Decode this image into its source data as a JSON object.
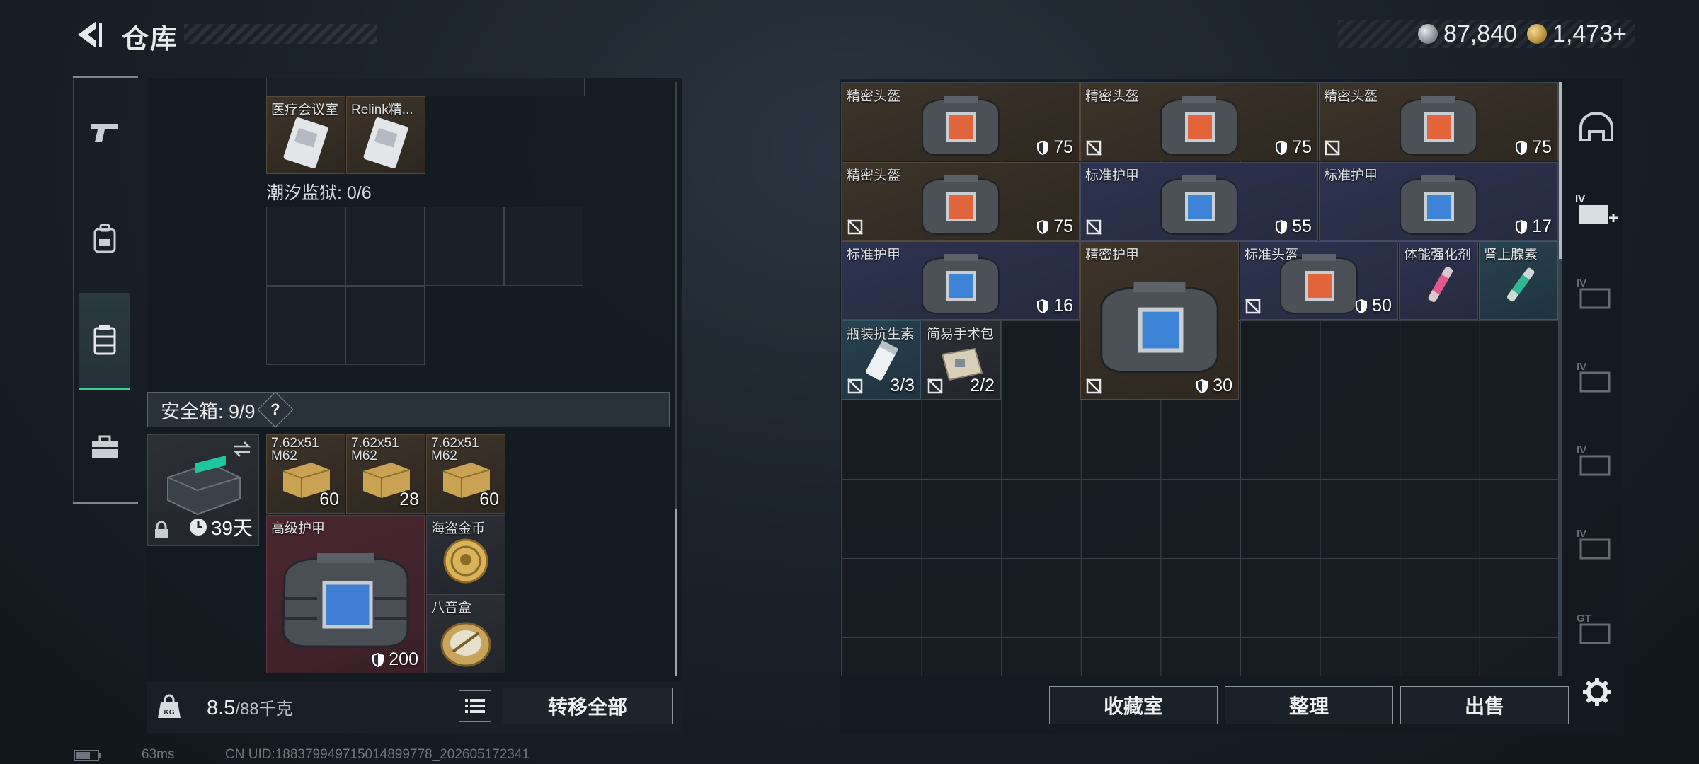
{
  "header": {
    "title": "仓库",
    "silver_value": "87,840",
    "gold_value": "1,473",
    "plus": "+"
  },
  "left_panel": {
    "top_items": [
      {
        "label": "医疗会议室",
        "kind": "keycard"
      },
      {
        "label": "Relink精...",
        "kind": "keycard"
      }
    ],
    "prison_label": "潮汐监狱: 0/6",
    "safebox_label": "安全箱: 9/9",
    "safebox_help": "?",
    "safebox_timer": "39天",
    "ammo": [
      {
        "label": "7.62x51\nM62",
        "count": "60"
      },
      {
        "label": "7.62x51\nM62",
        "count": "28"
      },
      {
        "label": "7.62x51\nM62",
        "count": "60"
      }
    ],
    "armor_label": "高级护甲",
    "armor_dura": "200",
    "coin_label": "海盗金币",
    "music_box_label": "八音盒",
    "weight_value": "8.5",
    "weight_max": "/88千克",
    "transfer_button": "转移全部"
  },
  "right_panel": {
    "items": [
      {
        "label": "精密头盔",
        "dura": "75",
        "color": "brown",
        "screen": "orange",
        "noins": false
      },
      {
        "label": "精密头盔",
        "dura": "75",
        "color": "brown",
        "screen": "orange",
        "noins": true
      },
      {
        "label": "精密头盔",
        "dura": "75",
        "color": "brown",
        "screen": "orange",
        "noins": true
      },
      {
        "label": "精密头盔",
        "dura": "75",
        "color": "brown",
        "screen": "orange",
        "noins": true
      },
      {
        "label": "标准护甲",
        "dura": "55",
        "color": "blue",
        "screen": "blue",
        "noins": true
      },
      {
        "label": "标准护甲",
        "dura": "17",
        "color": "blue",
        "screen": "blue",
        "noins": false
      },
      {
        "label": "标准护甲",
        "dura": "16",
        "color": "blue",
        "screen": "blue",
        "noins": false
      },
      {
        "label": "精密护甲",
        "dura": "30",
        "color": "brown",
        "screen": "blue",
        "noins": true
      },
      {
        "label": "标准头盔",
        "dura": "50",
        "color": "blue",
        "screen": "orange",
        "noins": true
      },
      {
        "label": "体能强化剂",
        "color": "blue"
      },
      {
        "label": "肾上腺素",
        "color": "teal"
      },
      {
        "label": "瓶装抗生素",
        "count": "3/3",
        "color": "teal",
        "noins": true
      },
      {
        "label": "简易手术包",
        "count": "2/2",
        "color": "dark",
        "noins": true
      }
    ],
    "buttons": {
      "collection": "收藏室",
      "sort": "整理",
      "sell": "出售"
    }
  },
  "footer": {
    "ping": "63ms",
    "uid": "CN UID:188379949715014899778_202605172341"
  },
  "colors": {
    "accent_green": "#3ed29a",
    "brown_cell": "#3e3429",
    "blue_cell": "#2e3450",
    "red_cell": "#4a2730"
  },
  "icons": {
    "nav": [
      "gun-icon",
      "backpack-icon",
      "container-icon",
      "toolbox-icon"
    ],
    "right": [
      "helmet-icon",
      "add-storage-icon",
      "storage-tier-icon",
      "storage-tier-icon",
      "storage-tier-icon",
      "storage-tier-icon",
      "storage-tier-icon",
      "settings-icon"
    ]
  }
}
